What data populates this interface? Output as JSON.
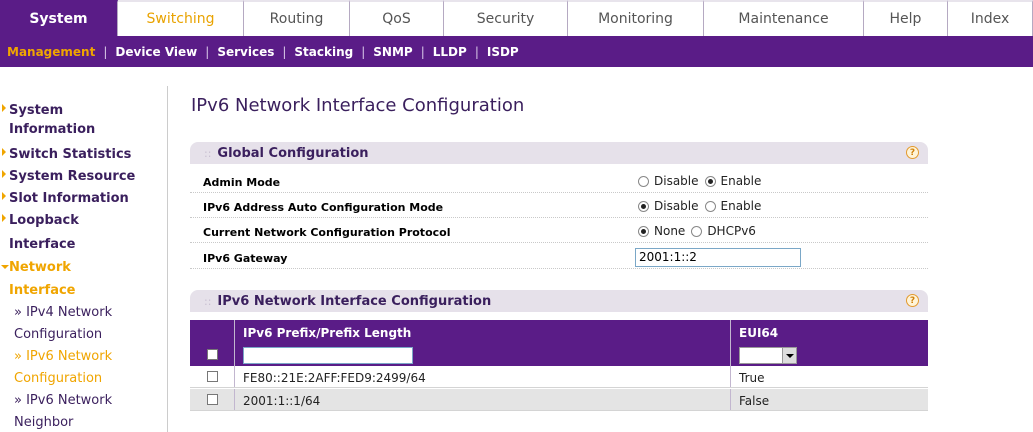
{
  "top_tabs": [
    "System",
    "Switching",
    "Routing",
    "QoS",
    "Security",
    "Monitoring",
    "Maintenance",
    "Help",
    "Index"
  ],
  "sub_menu": [
    "Management",
    "Device View",
    "Services",
    "Stacking",
    "SNMP",
    "LLDP",
    "ISDP"
  ],
  "left_nav": {
    "items": [
      "System",
      "Information",
      "Switch Statistics",
      "System Resource",
      "Slot Information",
      "Loopback",
      "Interface",
      "Network",
      "Interface"
    ],
    "subitems": [
      "» IPv4 Network",
      "Configuration",
      "» IPv6 Network",
      "Configuration",
      "» IPv6 Network",
      "Neighbor"
    ]
  },
  "page_title": "IPv6 Network Interface Configuration",
  "global_config": {
    "title": "Global Configuration",
    "help_icon": "?",
    "rows": [
      {
        "label": "Admin Mode",
        "opt1": "Disable",
        "opt2": "Enable",
        "selected": "Enable"
      },
      {
        "label": "IPv6 Address Auto Configuration Mode",
        "opt1": "Disable",
        "opt2": "Enable",
        "selected": "Disable"
      },
      {
        "label": "Current Network Configuration Protocol",
        "opt1": "None",
        "opt2": "DHCPv6",
        "selected": "None"
      }
    ],
    "gateway_label": "IPv6 Gateway",
    "gateway_value": "2001:1::2"
  },
  "table_panel": {
    "title": "IPv6 Network Interface Configuration",
    "help_icon": "?",
    "headers": [
      "IPv6 Prefix/Prefix Length",
      "EUI64"
    ],
    "rows": [
      {
        "prefix": "FE80::21E:2AFF:FED9:2499/64",
        "eui64": "True"
      },
      {
        "prefix": "2001:1::1/64",
        "eui64": "False"
      }
    ]
  },
  "colors": {
    "purple": "#5a1c87",
    "orange": "#f0a500",
    "dark_text": "#3a1f5d"
  }
}
